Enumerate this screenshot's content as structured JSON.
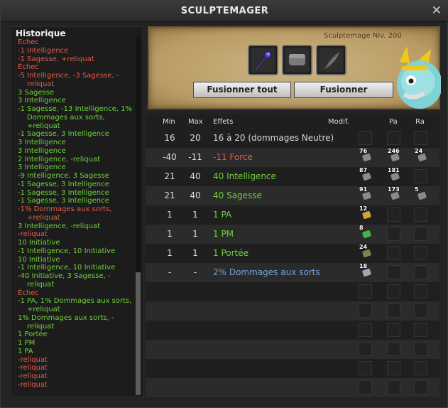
{
  "window": {
    "title": "SCULPTEMAGER",
    "close_icon": "close-icon"
  },
  "history": {
    "title": "Historique",
    "entries": [
      {
        "text": "Échec",
        "color": "red",
        "cont": false
      },
      {
        "text": "-1 Intelligence",
        "color": "red",
        "cont": false
      },
      {
        "text": "-1 Sagesse, +reliquat",
        "color": "red",
        "cont": false
      },
      {
        "text": "Échec",
        "color": "red",
        "cont": false
      },
      {
        "text": "-5 Intelligence, -3 Sagesse, -",
        "color": "red",
        "cont": false
      },
      {
        "text": "reliquat",
        "color": "red",
        "cont": true
      },
      {
        "text": "3 Sagesse",
        "color": "green",
        "cont": false
      },
      {
        "text": "3 Intelligence",
        "color": "green",
        "cont": false
      },
      {
        "text": "-1 Sagesse, -13 Intelligence, 1%",
        "color": "green",
        "cont": false
      },
      {
        "text": "Dommages aux sorts,",
        "color": "green",
        "cont": true
      },
      {
        "text": "+reliquat",
        "color": "green",
        "cont": true
      },
      {
        "text": "-1 Sagesse, 3 Intelligence",
        "color": "green",
        "cont": false
      },
      {
        "text": "3 Intelligence",
        "color": "green",
        "cont": false
      },
      {
        "text": "3 Intelligence",
        "color": "green",
        "cont": false
      },
      {
        "text": "2 Intelligence, -reliquat",
        "color": "green",
        "cont": false
      },
      {
        "text": "3 Intelligence",
        "color": "green",
        "cont": false
      },
      {
        "text": "-9 Intelligence, 3 Sagesse",
        "color": "green",
        "cont": false
      },
      {
        "text": "-1 Sagesse, 3 Intelligence",
        "color": "green",
        "cont": false
      },
      {
        "text": "-1 Sagesse, 3 Intelligence",
        "color": "green",
        "cont": false
      },
      {
        "text": "-1 Sagesse, 3 Intelligence",
        "color": "green",
        "cont": false
      },
      {
        "text": "-1% Dommages aux sorts,",
        "color": "red",
        "cont": false
      },
      {
        "text": "+reliquat",
        "color": "red",
        "cont": true
      },
      {
        "text": "3 Intelligence, -reliquat",
        "color": "green",
        "cont": false
      },
      {
        "text": "-reliquat",
        "color": "red",
        "cont": false
      },
      {
        "text": "10 Initiative",
        "color": "green",
        "cont": false
      },
      {
        "text": "-1 Intelligence, 10 Initiative",
        "color": "green",
        "cont": false
      },
      {
        "text": "10 Initiative",
        "color": "green",
        "cont": false
      },
      {
        "text": "-1 Intelligence, 10 Initiative",
        "color": "green",
        "cont": false
      },
      {
        "text": "-40 Initiative, 3 Sagesse, -",
        "color": "green",
        "cont": false
      },
      {
        "text": "reliquat",
        "color": "green",
        "cont": true
      },
      {
        "text": "Échec",
        "color": "red",
        "cont": false
      },
      {
        "text": "-1 PA, 1% Dommages aux sorts,",
        "color": "green",
        "cont": false
      },
      {
        "text": "+reliquat",
        "color": "green",
        "cont": true
      },
      {
        "text": "1% Dommages aux sorts, -",
        "color": "green",
        "cont": false
      },
      {
        "text": "reliquat",
        "color": "green",
        "cont": true
      },
      {
        "text": "1 Portée",
        "color": "green",
        "cont": false
      },
      {
        "text": "1 PM",
        "color": "green",
        "cont": false
      },
      {
        "text": "1 PA",
        "color": "green",
        "cont": false
      },
      {
        "text": "-reliquat",
        "color": "red",
        "cont": false
      },
      {
        "text": "-reliquat",
        "color": "red",
        "cont": false
      },
      {
        "text": "-reliquat",
        "color": "red",
        "cont": false
      },
      {
        "text": "-reliquat",
        "color": "red",
        "cont": false
      }
    ]
  },
  "forge": {
    "level": "Sculptemage Niv. 200",
    "slots": [
      {
        "icon": "staff-icon"
      },
      {
        "icon": "rune-slot-icon"
      },
      {
        "icon": "feather-icon"
      }
    ],
    "fuse_all_label": "Fusionner tout",
    "fuse_label": "Fusionner"
  },
  "table": {
    "headers": {
      "min": "Min",
      "max": "Max",
      "effects": "Effets",
      "modif": "Modif.",
      "pa": "Pa",
      "ra": "Ra"
    },
    "rows": [
      {
        "min": "16",
        "max": "20",
        "effect": "16 à 20 (dommages Neutre)",
        "tone": "neutral",
        "runes": [
          "",
          "",
          ""
        ]
      },
      {
        "min": "-40",
        "max": "-11",
        "effect": "-11 Force",
        "tone": "red",
        "runes": [
          "76",
          "246",
          "24"
        ]
      },
      {
        "min": "21",
        "max": "40",
        "effect": "40 Intelligence",
        "tone": "green",
        "runes": [
          "87",
          "181",
          ""
        ]
      },
      {
        "min": "21",
        "max": "40",
        "effect": "40 Sagesse",
        "tone": "green",
        "runes": [
          "91",
          "173",
          "5"
        ]
      },
      {
        "min": "1",
        "max": "1",
        "effect": "1 PA",
        "tone": "green",
        "runes": [
          "12",
          "",
          ""
        ]
      },
      {
        "min": "1",
        "max": "1",
        "effect": "1 PM",
        "tone": "green",
        "runes": [
          "8",
          "",
          ""
        ]
      },
      {
        "min": "1",
        "max": "1",
        "effect": "1 Portée",
        "tone": "green",
        "runes": [
          "24",
          "",
          ""
        ]
      },
      {
        "min": "-",
        "max": "-",
        "effect": "2% Dommages aux sorts",
        "tone": "blue",
        "runes": [
          "18",
          "",
          ""
        ]
      },
      {
        "min": "",
        "max": "",
        "effect": "",
        "tone": "neutral",
        "runes": [
          "",
          "",
          ""
        ]
      },
      {
        "min": "",
        "max": "",
        "effect": "",
        "tone": "neutral",
        "runes": [
          "",
          "",
          ""
        ]
      },
      {
        "min": "",
        "max": "",
        "effect": "",
        "tone": "neutral",
        "runes": [
          "",
          "",
          ""
        ]
      },
      {
        "min": "",
        "max": "",
        "effect": "",
        "tone": "neutral",
        "runes": [
          "",
          "",
          ""
        ]
      },
      {
        "min": "",
        "max": "",
        "effect": "",
        "tone": "neutral",
        "runes": [
          "",
          "",
          ""
        ]
      },
      {
        "min": "",
        "max": "",
        "effect": "",
        "tone": "neutral",
        "runes": [
          "",
          "",
          ""
        ]
      }
    ],
    "rune_colors": {
      "Force": "#8a8a8a",
      "Intelligence": "#8a8a8a",
      "Sagesse": "#8a8a8a",
      "PA": "#d4a13a",
      "PM": "#3fb54a",
      "Portee": "#6f8a4a",
      "DommagesSorts": "#9aa8b5"
    }
  }
}
